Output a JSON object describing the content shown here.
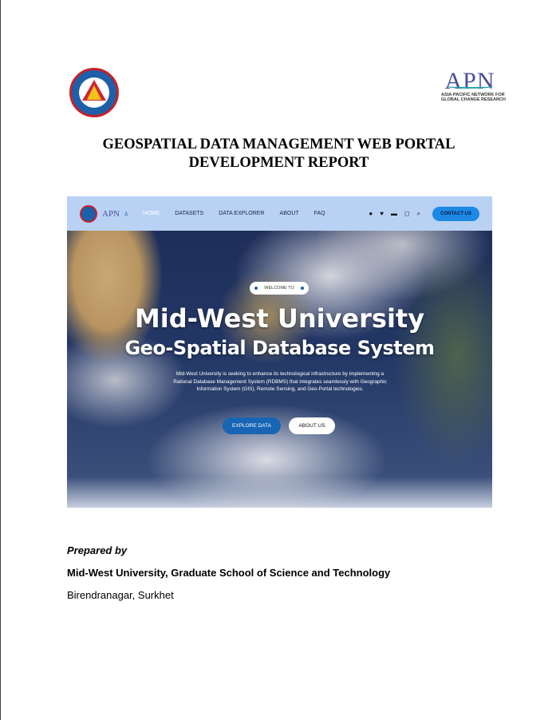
{
  "logos": {
    "left": "Mid-West University seal",
    "right_main": "APN",
    "right_sub1": "ASIA-PACIFIC NETWORK FOR",
    "right_sub2": "GLOBAL CHANGE RESEARCH"
  },
  "title": {
    "line1": "GEOSPATIAL DATA MANAGEMENT WEB PORTAL",
    "line2": "DEVELOPMENT REPORT"
  },
  "screenshot": {
    "nav": {
      "logo_apn": "APN",
      "items": [
        "HOME",
        "DATASETS",
        "DATA EXPLORER",
        "ABOUT",
        "FAQ"
      ],
      "icons": [
        "facebook-icon",
        "twitter-icon",
        "youtube-icon",
        "instagram-icon",
        "search-icon"
      ],
      "contact": "CONTACT US"
    },
    "welcome": "WELCOME TO",
    "heading1": "Mid-West University",
    "heading2": "Geo-Spatial Database System",
    "description": "Mid-West University is seeking to enhance its technological infrastructure by implementing a Rational Database Management System (RDBMS) that integrates seamlessly with Geographic Information System (GIS), Remote Sensing, and Geo-Portal technologies.",
    "btn_explore": "EXPLORE DATA",
    "btn_about": "ABOUT US"
  },
  "footer": {
    "prepared_by": "Prepared by",
    "organization": "Mid-West University, Graduate School of Science and Technology",
    "location": "Birendranagar, Surkhet"
  },
  "colors": {
    "accent": "#1e88e5",
    "nav_bg": "#b9d2f4"
  }
}
